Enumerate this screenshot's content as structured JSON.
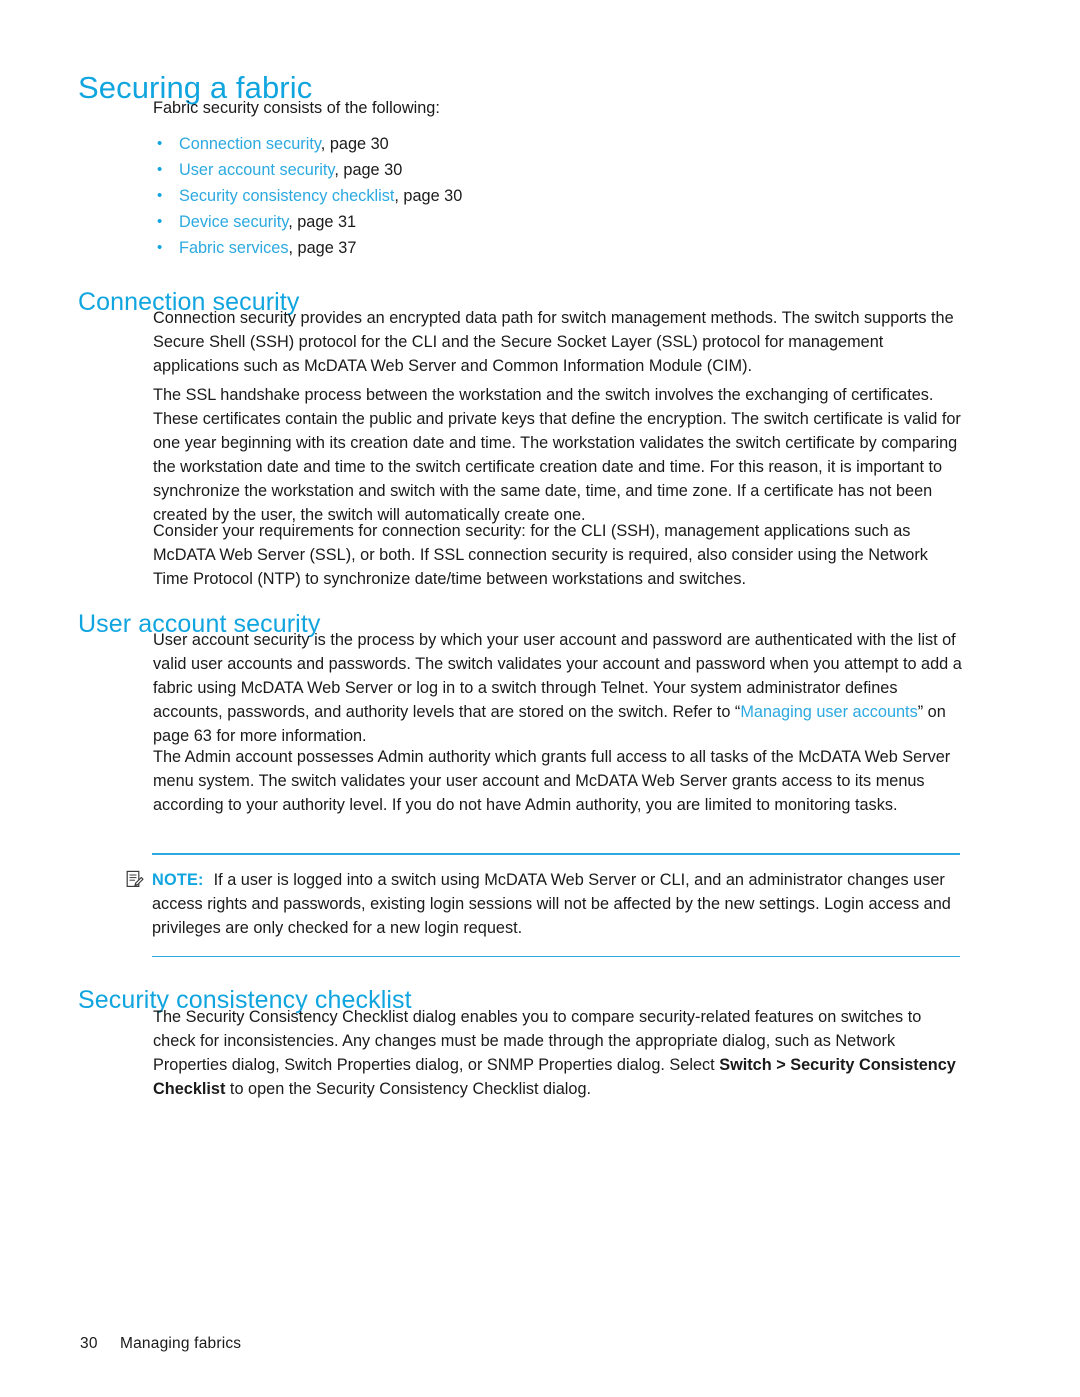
{
  "page": {
    "title": "Securing a fabric",
    "lead": "Fabric security consists of the following:",
    "accent_color": "#11a5df",
    "link_color": "#2ba9e0",
    "text_color": "#1a1a1a"
  },
  "toc_bullets": [
    {
      "link": "Connection security",
      "tail": ", page 30"
    },
    {
      "link": "User account security",
      "tail": ", page 30"
    },
    {
      "link": "Security consistency checklist",
      "tail": ", page 30"
    },
    {
      "link": "Device security",
      "tail": ", page 31"
    },
    {
      "link": "Fabric services",
      "tail": ", page 37"
    }
  ],
  "sections": {
    "connection_security": {
      "heading": "Connection security",
      "p1": "Connection security provides an encrypted data path for switch management methods. The switch supports the Secure Shell (SSH) protocol for the CLI and the Secure Socket Layer (SSL) protocol for management applications such as McDATA Web Server and Common Information Module (CIM).",
      "p2": "The SSL handshake process between the workstation and the switch involves the exchanging of certificates. These certificates contain the public and private keys that define the encryption. The switch certificate is valid for one year beginning with its creation date and time. The workstation validates the switch certificate by comparing the workstation date and time to the switch certificate creation date and time. For this reason, it is important to synchronize the workstation and switch with the same date, time, and time zone. If a certificate has not been created by the user, the switch will automatically create one.",
      "p3": "Consider your requirements for connection security: for the CLI (SSH), management applications such as McDATA Web Server (SSL), or both. If SSL connection security is required, also consider using the Network Time Protocol (NTP) to synchronize date/time between workstations and switches."
    },
    "user_account_security": {
      "heading": "User account security",
      "p1_before_link": "User account security is the process by which your user account and password are authenticated with the list of valid user accounts and passwords. The switch validates your account and password when you attempt to add a fabric using McDATA Web Server or log in to a switch through Telnet. Your system administrator defines accounts, passwords, and authority levels that are stored on the switch. Refer to “",
      "p1_link": "Managing user accounts",
      "p1_after_link": "” on page 63 for more information.",
      "p2": "The Admin account possesses Admin authority which grants full access to all tasks of the McDATA Web Server menu system. The switch validates your user account and McDATA Web Server grants access to its menus according to your authority level. If you do not have Admin authority, you are limited to monitoring tasks."
    },
    "note": {
      "icon": "notepad-pencil-icon",
      "label": "NOTE:",
      "text": "If a user is logged into a switch using McDATA Web Server or CLI, and an administrator changes user access rights and passwords, existing login sessions will not be affected by the new settings. Login access and privileges are only checked for a new login request."
    },
    "security_consistency_checklist": {
      "heading": "Security consistency checklist",
      "p1_part1": "The Security Consistency Checklist dialog enables you to compare security-related features on switches to check for inconsistencies. Any changes must be made through the appropriate dialog, such as Network Properties dialog, Switch Properties dialog, or SNMP Properties dialog. Select ",
      "p1_bold": "Switch > Security Consistency Checklist",
      "p1_part2": " to open the Security Consistency Checklist dialog."
    }
  },
  "footer": {
    "page_number": "30",
    "chapter": "Managing fabrics"
  }
}
